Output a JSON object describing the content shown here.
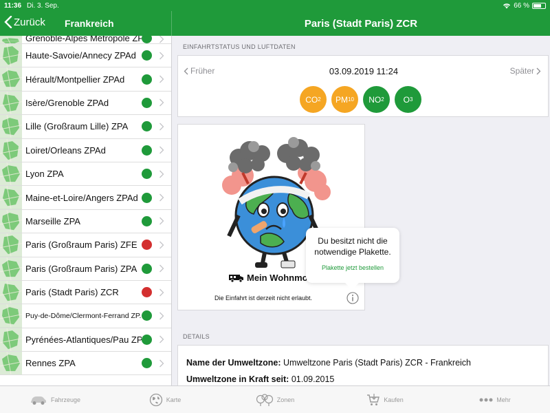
{
  "statusbar": {
    "time": "11:36",
    "date": "Di. 3. Sep.",
    "battery": "66 %",
    "battery_level": 0.66
  },
  "navbar": {
    "back_label": "Zurück",
    "list_title": "Frankreich",
    "detail_title": "Paris (Stadt Paris) ZCR"
  },
  "zones": [
    {
      "name": "Grenoble-Alpes Métropole ZPA",
      "status": "green",
      "partial": true
    },
    {
      "name": "Haute-Savoie/Annecy ZPAd",
      "status": "green"
    },
    {
      "name": "Hérault/Montpellier ZPAd",
      "status": "green"
    },
    {
      "name": "Isère/Grenoble ZPAd",
      "status": "green"
    },
    {
      "name": "Lille (Großraum Lille) ZPA",
      "status": "green"
    },
    {
      "name": "Loiret/Orleans ZPAd",
      "status": "green"
    },
    {
      "name": "Lyon ZPA",
      "status": "green"
    },
    {
      "name": "Maine-et-Loire/Angers ZPAd",
      "status": "green"
    },
    {
      "name": "Marseille ZPA",
      "status": "green"
    },
    {
      "name": "Paris (Großraum Paris) ZFE",
      "status": "red"
    },
    {
      "name": "Paris (Großraum Paris) ZPA",
      "status": "green"
    },
    {
      "name": "Paris (Stadt Paris) ZCR",
      "status": "red"
    },
    {
      "name": "Puy-de-Dôme/Clermont-Ferrand ZP...",
      "status": "green",
      "small": true
    },
    {
      "name": "Pyrénées-Atlantiques/Pau ZPAd",
      "status": "green"
    },
    {
      "name": "Rennes ZPA",
      "status": "green"
    }
  ],
  "status_section": {
    "header": "EINFAHRTSTATUS UND LUFTDATEN",
    "prev_label": "Früher",
    "next_label": "Später",
    "datetime": "03.09.2019 11:24"
  },
  "pollutants": [
    {
      "base": "CO",
      "sub": "2",
      "color": "#f5a623"
    },
    {
      "base": "PM",
      "sub": "10",
      "color": "#f5a623"
    },
    {
      "base": "NO",
      "sub": "2",
      "color": "#1f9a3a"
    },
    {
      "base": "O",
      "sub": "3",
      "color": "#1f9a3a"
    }
  ],
  "vehicle": {
    "name": "Mein Wohnmobil",
    "entry_text": "Die Einfahrt ist derzeit nicht erlaubt."
  },
  "tooltip": {
    "message": "Du besitzt nicht die notwendige Plakette.",
    "order_label": "Plakette jetzt bestellen"
  },
  "details": {
    "header": "DETAILS",
    "zone_label": "Name der Umweltzone:",
    "zone_value": "Umweltzone Paris (Stadt Paris) ZCR - Frankreich",
    "since_label": "Umweltzone in Kraft seit:",
    "since_value": "01.09.2015"
  },
  "tabs": [
    {
      "label": "Fahrzeuge",
      "icon": "car-icon"
    },
    {
      "label": "Karte",
      "icon": "globe-icon"
    },
    {
      "label": "Zonen",
      "icon": "zones-icon"
    },
    {
      "label": "Kaufen",
      "icon": "cart-icon"
    },
    {
      "label": "Mehr",
      "icon": "more-icon"
    }
  ],
  "colors": {
    "brand_green": "#1f9a3a",
    "status_green": "#1f9a3a",
    "status_red": "#d32f2f",
    "warning_orange": "#f5a623"
  }
}
